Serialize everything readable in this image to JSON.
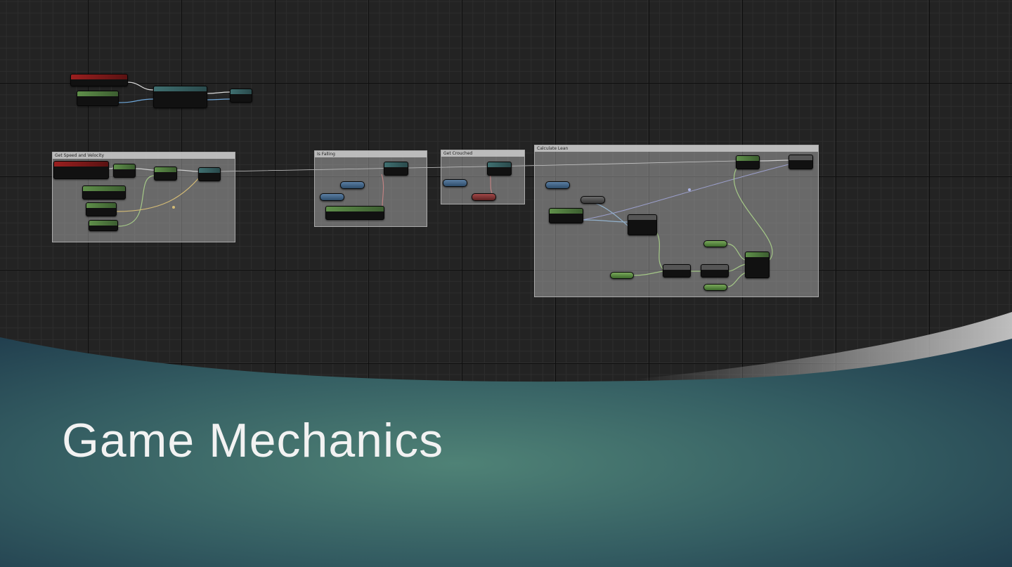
{
  "slide": {
    "title": "Game Mechanics"
  },
  "graph": {
    "comments": [
      {
        "id": "speed",
        "title": "Get Speed and Velocity"
      },
      {
        "id": "falling",
        "title": "Is Falling"
      },
      {
        "id": "crouched",
        "title": "Get Crouched"
      },
      {
        "id": "calc",
        "title": "Calculate Lean"
      }
    ]
  },
  "colors": {
    "grid_bg": "#232323",
    "slide_teal_center": "#4f8276",
    "slide_teal_edge": "#1f3b4c",
    "title_color": "#f2f2f2"
  }
}
